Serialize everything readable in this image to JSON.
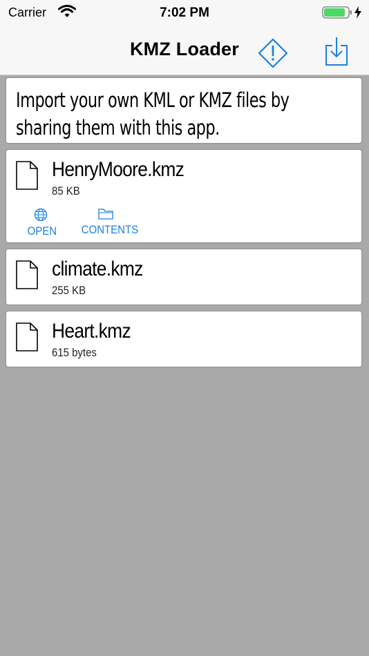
{
  "status": {
    "carrier": "Carrier",
    "time": "7:02 PM"
  },
  "nav": {
    "title": "KMZ Loader",
    "icons": [
      "warning-icon",
      "import-icon"
    ],
    "accent": "#1a7fe0"
  },
  "info": {
    "text": "Import your own KML or KMZ files by sharing them with this app."
  },
  "files": [
    {
      "name": "HenryMoore.kmz",
      "size": "85 KB",
      "actions": [
        {
          "label": "OPEN",
          "icon": "globe-icon"
        },
        {
          "label": "CONTENTS",
          "icon": "folder-icon"
        }
      ]
    },
    {
      "name": "climate.kmz",
      "size": "255 KB"
    },
    {
      "name": "Heart.kmz",
      "size": "615 bytes"
    }
  ]
}
